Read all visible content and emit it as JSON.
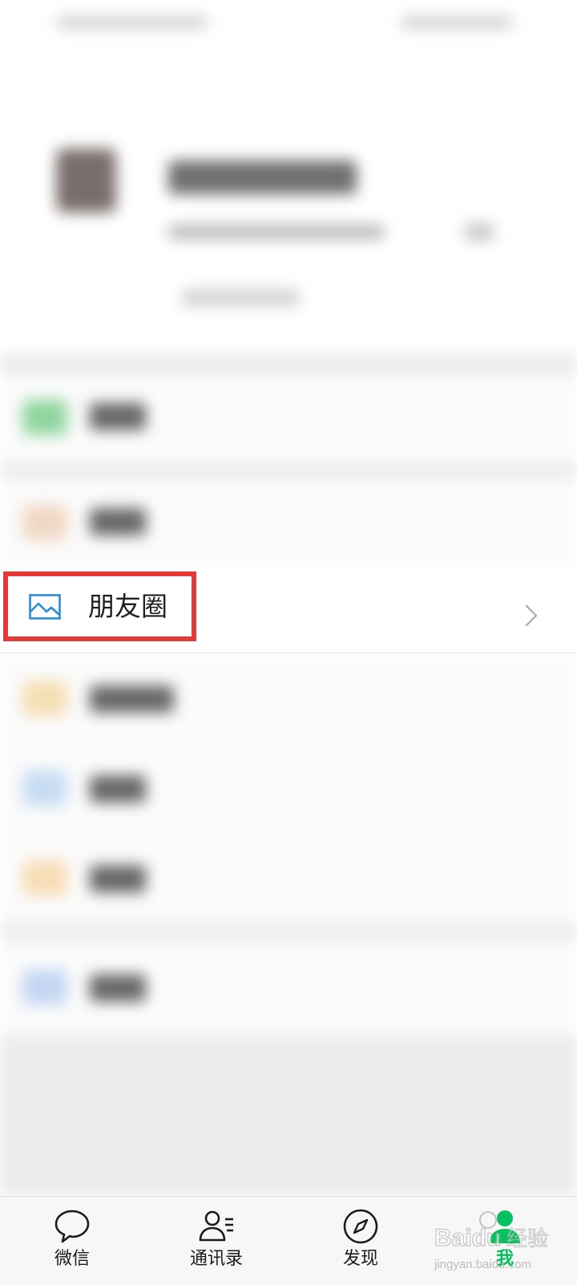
{
  "moments_row": {
    "label": "朋友圈",
    "icon": "moments-image-icon",
    "chevron_icon": "chevron-right-icon"
  },
  "tabbar": {
    "tabs": [
      {
        "label": "微信",
        "icon": "chat-bubble-icon",
        "active": false
      },
      {
        "label": "通讯录",
        "icon": "contacts-icon",
        "active": false
      },
      {
        "label": "发现",
        "icon": "compass-icon",
        "active": false
      },
      {
        "label": "我",
        "icon": "person-icon",
        "active": true
      }
    ]
  },
  "colors": {
    "accent": "#07c160",
    "highlight": "#e53935",
    "moments_icon": "#2a8cd8"
  },
  "watermark": {
    "brand": "Baidu经验",
    "url": "jingyan.baidu.com"
  }
}
